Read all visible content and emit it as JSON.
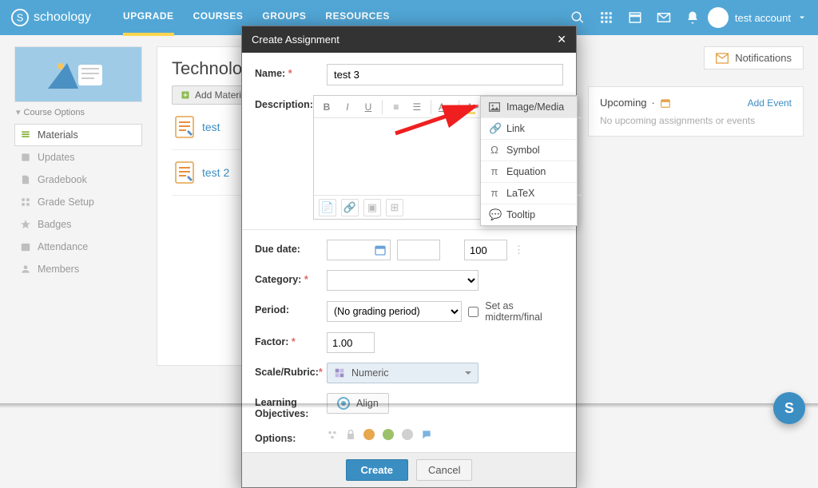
{
  "nav": {
    "brand": "schoology",
    "links": {
      "upgrade": "UPGRADE",
      "courses": "COURSES",
      "groups": "GROUPS",
      "resources": "RESOURCES"
    },
    "account_name": "test account"
  },
  "sidebar": {
    "course_options": "Course Options",
    "items": [
      {
        "label": "Materials"
      },
      {
        "label": "Updates"
      },
      {
        "label": "Gradebook"
      },
      {
        "label": "Grade Setup"
      },
      {
        "label": "Badges"
      },
      {
        "label": "Attendance"
      },
      {
        "label": "Members"
      }
    ]
  },
  "main": {
    "title_prefix": "Technology:",
    "add_materials": "Add Materials",
    "items": [
      {
        "label": "test"
      },
      {
        "label": "test 2"
      }
    ]
  },
  "rightcol": {
    "notifications": "Notifications",
    "upcoming": "Upcoming",
    "add_event": "Add Event",
    "empty": "No upcoming assignments or events"
  },
  "modal": {
    "title": "Create Assignment",
    "labels": {
      "name": "Name:",
      "description": "Description:",
      "due_date": "Due date:",
      "category": "Category:",
      "period": "Period:",
      "factor": "Factor:",
      "scale": "Scale/Rubric:",
      "learning_objectives_1": "Learning",
      "learning_objectives_2": "Objectives:",
      "options": "Options:"
    },
    "name_value": "test 3",
    "points_value": "100",
    "period_value": "(No grading period)",
    "midterm_label": "Set as midterm/final",
    "factor_value": "1.00",
    "scale_value": "Numeric",
    "align_label": "Align",
    "insert_menu": {
      "image_media": "Image/Media",
      "link": "Link",
      "symbol": "Symbol",
      "equation": "Equation",
      "latex": "LaTeX",
      "tooltip": "Tooltip"
    },
    "buttons": {
      "create": "Create",
      "cancel": "Cancel"
    }
  },
  "help_letter": "S"
}
